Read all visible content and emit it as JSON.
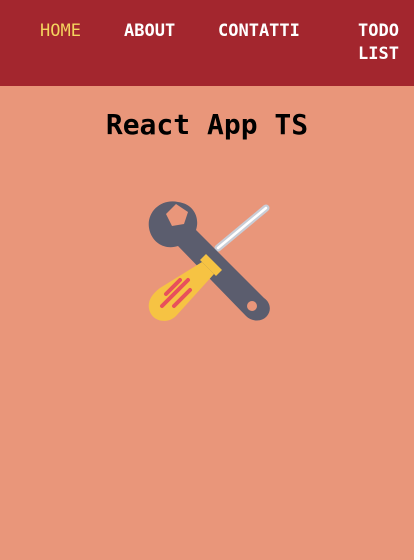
{
  "nav": {
    "items": [
      {
        "label": "HOME",
        "active": true
      },
      {
        "label": "ABOUT",
        "active": false
      },
      {
        "label": "CONTATTI",
        "active": false
      },
      {
        "label": "TODO\nLIST",
        "active": false
      }
    ]
  },
  "main": {
    "title": "React App TS",
    "icon": "wrench-screwdriver-icon"
  },
  "colors": {
    "background": "#e9967a",
    "navbar": "#a3262e",
    "nav_active": "#f4d35e",
    "nav_text": "#ffffff"
  }
}
